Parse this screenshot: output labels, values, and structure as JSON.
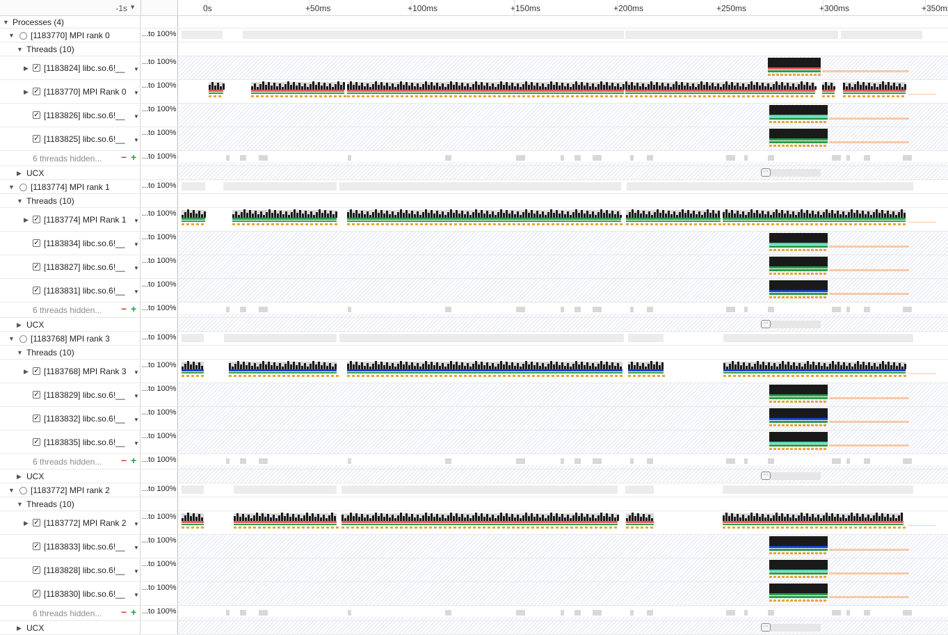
{
  "timeline": {
    "start_label": "-1s",
    "ticks": [
      "0s",
      "+50ms",
      "+100ms",
      "+150ms",
      "+200ms",
      "+250ms",
      "+300ms",
      "+350ms"
    ]
  },
  "scale_label": "...to 100%",
  "processes_header": "Processes (4)",
  "threads_header": "Threads (10)",
  "hidden_label": "6 threads hidden...",
  "ucx_label": "UCX",
  "processes": [
    {
      "name": "[1183770] MPI rank 0",
      "main_thread": "[1183770] MPI Rank 0",
      "threads": [
        "[1183824] libc.so.6!__",
        "[1183770] MPI Rank 0",
        "[1183826] libc.so.6!__",
        "[1183825] libc.so.6!__"
      ],
      "thread_kinds": [
        "expandable",
        "main",
        "plain",
        "plain"
      ]
    },
    {
      "name": "[1183774] MPI rank 1",
      "threads": [
        "[1183774] MPI Rank 1",
        "[1183834] libc.so.6!__",
        "[1183827] libc.so.6!__",
        "[1183831] libc.so.6!__"
      ],
      "thread_kinds": [
        "main",
        "plain",
        "plain",
        "plain"
      ]
    },
    {
      "name": "[1183768] MPI rank 3",
      "threads": [
        "[1183768] MPI Rank 3",
        "[1183829] libc.so.6!__",
        "[1183832] libc.so.6!__",
        "[1183835] libc.so.6!__"
      ],
      "thread_kinds": [
        "main",
        "plain",
        "plain",
        "plain"
      ]
    },
    {
      "name": "[1183772] MPI rank 2",
      "threads": [
        "[1183772] MPI Rank 2",
        "[1183833] libc.so.6!__",
        "[1183828] libc.so.6!__",
        "[1183830] libc.so.6!__"
      ],
      "thread_kinds": [
        "main",
        "plain",
        "plain",
        "plain"
      ]
    }
  ],
  "colors": {
    "cpu_activity": "#1a1a1a",
    "idle_gray": "#d9d9d9",
    "mpi_red": "#e8565a",
    "mpi_green": "#2e9b4a",
    "mpi_blue": "#1f3fd6",
    "mpi_purple": "#9a3ad1",
    "sample_orange": "#e7a43a",
    "idle_peach": "#f7c9a8",
    "cuda_teal": "#4fd6b0"
  }
}
